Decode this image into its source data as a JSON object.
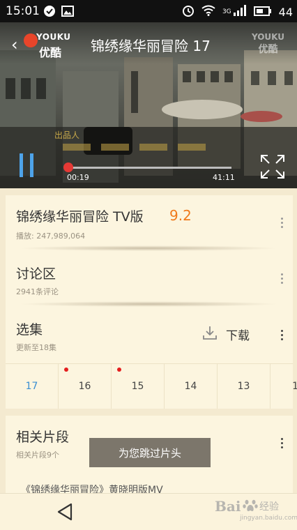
{
  "status_bar": {
    "time": "15:01",
    "network": "3G",
    "battery": "44",
    "left_icons": [
      "check-circle-icon",
      "image-icon"
    ],
    "right_icons": [
      "alarm-icon",
      "wifi-icon",
      "signal-icon",
      "battery-icon"
    ]
  },
  "player": {
    "logo_en": "YOUKU",
    "logo_cn": "优酷",
    "title": "锦绣缘华丽冒险 17",
    "watermark_en": "YOUKU",
    "watermark_cn": "优酷",
    "current_time": "00:19",
    "total_time": "41:11",
    "progress_fraction": 0.008,
    "state": "playing",
    "accent_color": "#4ea3ea",
    "progress_color": "#e53935"
  },
  "show_info": {
    "title": "锦绣缘华丽冒险 TV版",
    "rating": "9.2",
    "play_count": "播放: 247,989,064"
  },
  "discussion": {
    "title": "讨论区",
    "count": "2941条评论"
  },
  "episodes": {
    "title": "选集",
    "update": "更新至18集",
    "download_label": "下载",
    "items": [
      {
        "label": "17",
        "active": true,
        "new": false
      },
      {
        "label": "16",
        "active": false,
        "new": true
      },
      {
        "label": "15",
        "active": false,
        "new": true
      },
      {
        "label": "14",
        "active": false,
        "new": false
      },
      {
        "label": "13",
        "active": false,
        "new": false
      },
      {
        "label": "1",
        "active": false,
        "new": false
      }
    ]
  },
  "related": {
    "title": "相关片段",
    "count": "相关片段9个",
    "first_item": "《锦绣缘华丽冒险》黄晓明版MV"
  },
  "toast": "为您跳过片头",
  "watermark": {
    "text": "Bai",
    "cn": "经验",
    "url": "jingyan.baidu.com"
  }
}
